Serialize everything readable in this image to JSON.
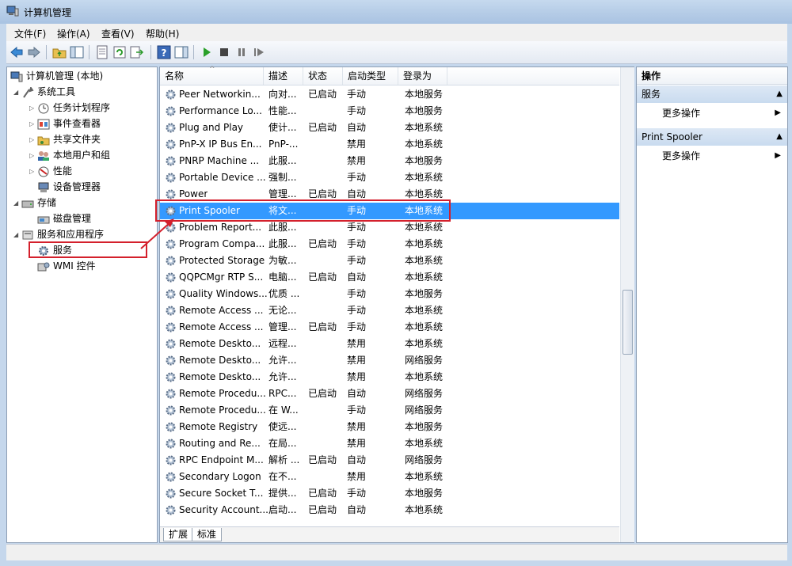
{
  "window": {
    "title": "计算机管理"
  },
  "menu": [
    "文件(F)",
    "操作(A)",
    "查看(V)",
    "帮助(H)"
  ],
  "tree": [
    {
      "label": "计算机管理 (本地)",
      "icon": "computer-icon"
    },
    {
      "label": "系统工具",
      "icon": "tools-icon"
    },
    {
      "label": "任务计划程序",
      "icon": "clock-icon"
    },
    {
      "label": "事件查看器",
      "icon": "event-viewer-icon"
    },
    {
      "label": "共享文件夹",
      "icon": "shared-folder-icon"
    },
    {
      "label": "本地用户和组",
      "icon": "users-icon"
    },
    {
      "label": "性能",
      "icon": "performance-icon"
    },
    {
      "label": "设备管理器",
      "icon": "device-manager-icon"
    },
    {
      "label": "存储",
      "icon": "storage-icon"
    },
    {
      "label": "磁盘管理",
      "icon": "disk-icon"
    },
    {
      "label": "服务和应用程序",
      "icon": "services-apps-icon"
    },
    {
      "label": "服务",
      "icon": "gear-icon"
    },
    {
      "label": "WMI 控件",
      "icon": "wmi-icon"
    }
  ],
  "columns": [
    "名称",
    "描述",
    "状态",
    "启动类型",
    "登录为"
  ],
  "services": [
    [
      "Peer Networkin...",
      "向对...",
      "已启动",
      "手动",
      "本地服务"
    ],
    [
      "Performance Lo...",
      "性能...",
      "",
      "手动",
      "本地服务"
    ],
    [
      "Plug and Play",
      "使计...",
      "已启动",
      "自动",
      "本地系统"
    ],
    [
      "PnP-X IP Bus En...",
      "PnP-...",
      "",
      "禁用",
      "本地系统"
    ],
    [
      "PNRP Machine ...",
      "此服...",
      "",
      "禁用",
      "本地服务"
    ],
    [
      "Portable Device ...",
      "强制...",
      "",
      "手动",
      "本地系统"
    ],
    [
      "Power",
      "管理...",
      "已启动",
      "自动",
      "本地系统"
    ],
    [
      "Print Spooler",
      "将文...",
      "",
      "手动",
      "本地系统"
    ],
    [
      "Problem Report...",
      "此服...",
      "",
      "手动",
      "本地系统"
    ],
    [
      "Program Compa...",
      "此服...",
      "已启动",
      "手动",
      "本地系统"
    ],
    [
      "Protected Storage",
      "为敏...",
      "",
      "手动",
      "本地系统"
    ],
    [
      "QQPCMgr RTP S...",
      "电脑...",
      "已启动",
      "自动",
      "本地系统"
    ],
    [
      "Quality Windows...",
      "优质 ...",
      "",
      "手动",
      "本地服务"
    ],
    [
      "Remote Access ...",
      "无论...",
      "",
      "手动",
      "本地系统"
    ],
    [
      "Remote Access ...",
      "管理...",
      "已启动",
      "手动",
      "本地系统"
    ],
    [
      "Remote Deskto...",
      "远程...",
      "",
      "禁用",
      "本地系统"
    ],
    [
      "Remote Deskto...",
      "允许...",
      "",
      "禁用",
      "网络服务"
    ],
    [
      "Remote Deskto...",
      "允许...",
      "",
      "禁用",
      "本地系统"
    ],
    [
      "Remote Procedu...",
      "RPC...",
      "已启动",
      "自动",
      "网络服务"
    ],
    [
      "Remote Procedu...",
      "在 W...",
      "",
      "手动",
      "网络服务"
    ],
    [
      "Remote Registry",
      "使远...",
      "",
      "禁用",
      "本地服务"
    ],
    [
      "Routing and Re...",
      "在局...",
      "",
      "禁用",
      "本地系统"
    ],
    [
      "RPC Endpoint M...",
      "解析 ...",
      "已启动",
      "自动",
      "网络服务"
    ],
    [
      "Secondary Logon",
      "在不...",
      "",
      "禁用",
      "本地系统"
    ],
    [
      "Secure Socket T...",
      "提供...",
      "已启动",
      "手动",
      "本地服务"
    ],
    [
      "Security Account...",
      "启动...",
      "已启动",
      "自动",
      "本地系统"
    ]
  ],
  "selected_index": 7,
  "bottom_tabs": [
    "扩展",
    "标准"
  ],
  "actions": {
    "title": "操作",
    "sections": [
      {
        "title": "服务",
        "item": "更多操作"
      },
      {
        "title": "Print Spooler",
        "item": "更多操作"
      }
    ]
  },
  "colors": {
    "selection": "#3399ff",
    "highlight_box": "#d4202c"
  }
}
